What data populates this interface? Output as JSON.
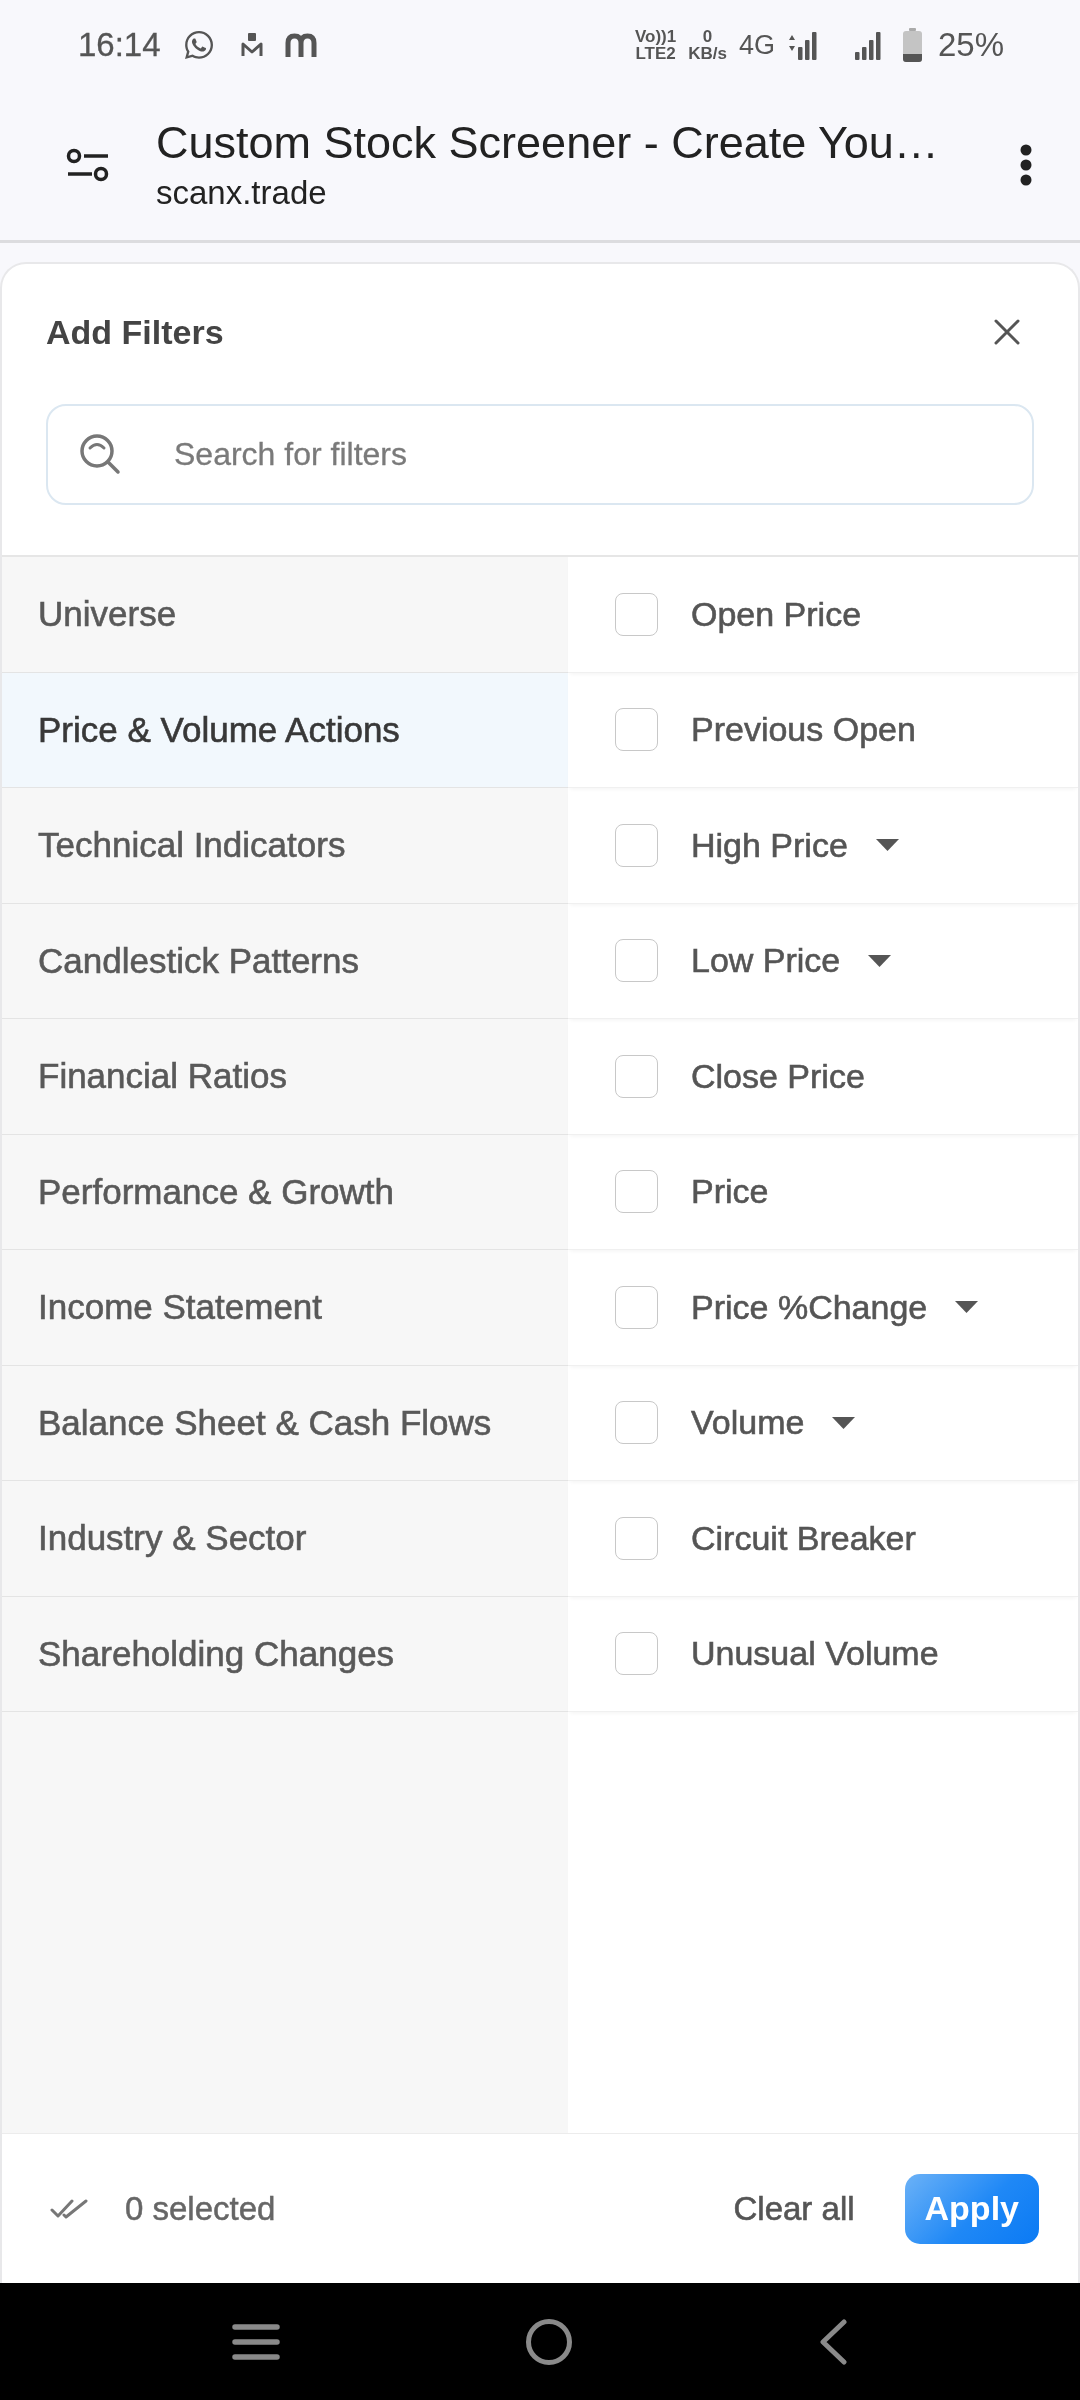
{
  "status_bar": {
    "time": "16:14",
    "volte_top": "Vo))1",
    "volte_bottom": "LTE2",
    "speed_value": "0",
    "speed_unit": "KB/s",
    "network": "4G",
    "battery": "25%"
  },
  "browser_bar": {
    "title": "Custom Stock Screener - Create You…",
    "url": "scanx.trade"
  },
  "panel": {
    "title": "Add Filters",
    "search": {
      "placeholder": "Search for filters"
    },
    "categories": [
      {
        "label": "Universe",
        "selected": false
      },
      {
        "label": "Price & Volume Actions",
        "selected": true
      },
      {
        "label": "Technical Indicators",
        "selected": false
      },
      {
        "label": "Candlestick Patterns",
        "selected": false
      },
      {
        "label": "Financial Ratios",
        "selected": false
      },
      {
        "label": "Performance & Growth",
        "selected": false
      },
      {
        "label": "Income Statement",
        "selected": false
      },
      {
        "label": "Balance Sheet & Cash Flows",
        "selected": false
      },
      {
        "label": "Industry & Sector",
        "selected": false
      },
      {
        "label": "Shareholding Changes",
        "selected": false
      }
    ],
    "filters": [
      {
        "label": "Open Price",
        "checked": false,
        "dropdown": false
      },
      {
        "label": "Previous Open",
        "checked": false,
        "dropdown": false
      },
      {
        "label": "High Price",
        "checked": false,
        "dropdown": true
      },
      {
        "label": "Low Price",
        "checked": false,
        "dropdown": true
      },
      {
        "label": "Close Price",
        "checked": false,
        "dropdown": false
      },
      {
        "label": "Price",
        "checked": false,
        "dropdown": false
      },
      {
        "label": "Price %Change",
        "checked": false,
        "dropdown": true
      },
      {
        "label": "Volume",
        "checked": false,
        "dropdown": true
      },
      {
        "label": "Circuit Breaker",
        "checked": false,
        "dropdown": false
      },
      {
        "label": "Unusual Volume",
        "checked": false,
        "dropdown": false
      }
    ]
  },
  "footer": {
    "selected_count": "0 selected",
    "clear_button": "Clear all",
    "apply_button": "Apply"
  }
}
